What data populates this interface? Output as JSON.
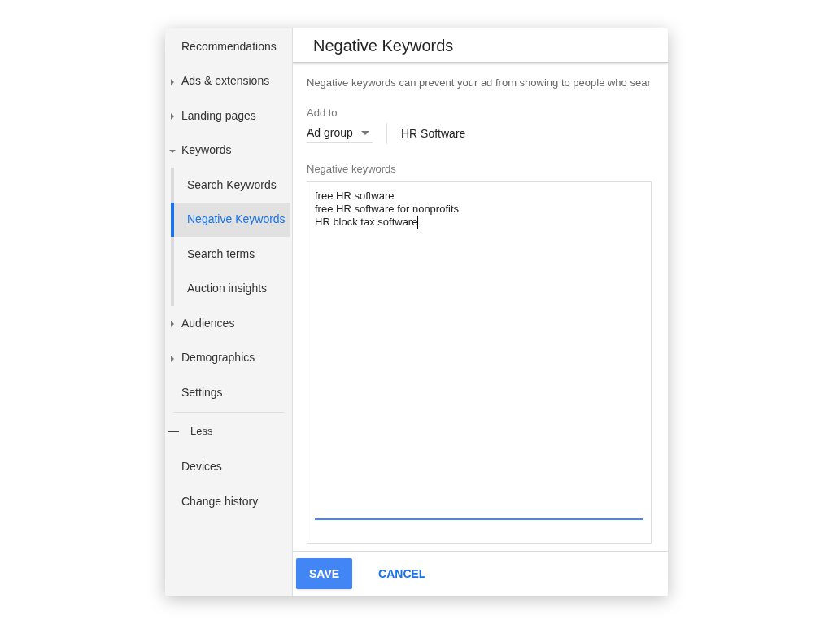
{
  "sidebar": {
    "items": [
      {
        "label": "Recommendations",
        "selected": false
      },
      {
        "label": "Ads & extensions",
        "expanded": false,
        "selected": false
      },
      {
        "label": "Landing pages",
        "expanded": false,
        "selected": false
      },
      {
        "label": "Keywords",
        "expanded": true,
        "selected": false,
        "children": [
          {
            "label": "Search Keywords",
            "selected": false
          },
          {
            "label": "Negative Keywords",
            "selected": true
          },
          {
            "label": "Search terms",
            "selected": false
          },
          {
            "label": "Auction insights",
            "selected": false
          }
        ]
      },
      {
        "label": "Audiences",
        "expanded": false,
        "selected": false
      },
      {
        "label": "Demographics",
        "expanded": false,
        "selected": false
      },
      {
        "label": "Settings",
        "selected": false
      }
    ],
    "toggle": {
      "label": "Less",
      "expanded": true
    },
    "more_items": [
      {
        "label": "Devices",
        "selected": false
      },
      {
        "label": "Change history",
        "selected": false
      }
    ]
  },
  "panel": {
    "title": "Negative Keywords",
    "description": "Negative keywords can prevent your ad from showing to people who sear",
    "add_to": {
      "label": "Add to",
      "level_select": "Ad group",
      "target": "HR Software"
    },
    "keywords": {
      "label": "Negative keywords",
      "value": "free HR software\nfree HR software for nonprofits\nHR block tax software",
      "focused": true
    },
    "buttons": [
      {
        "label": "SAVE",
        "kind": "primary"
      },
      {
        "label": "CANCEL",
        "kind": "text"
      }
    ]
  }
}
